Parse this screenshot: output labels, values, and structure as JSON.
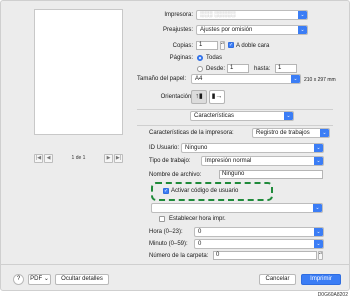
{
  "printer": {
    "label": "Impresora:",
    "value": "░░░ ░░░░░"
  },
  "presets": {
    "label": "Preajustes:",
    "value": "Ajustes por omisión"
  },
  "copies": {
    "label": "Copias:",
    "value": "1",
    "two_sided_label": "A doble cara"
  },
  "pages": {
    "label": "Páginas:",
    "all_label": "Todas",
    "from_label": "Desde:",
    "from_value": "1",
    "to_label": "hasta:",
    "to_value": "1"
  },
  "paper_size": {
    "label": "Tamaño del papel:",
    "value": "A4",
    "dims": "210 x 297 mm"
  },
  "orientation": {
    "label": "Orientación:",
    "portrait_glyph": "↑▮",
    "landscape_glyph": "▮→"
  },
  "section_menu": {
    "value": "Características"
  },
  "printer_features": {
    "label": "Características de la impresora:",
    "value": "Registro de trabajos"
  },
  "user_id": {
    "label": "ID Usuario:",
    "value": "Ninguno"
  },
  "job_type": {
    "label": "Tipo de trabajo:",
    "value": "Impresión normal"
  },
  "file_name": {
    "label": "Nombre de archivo:",
    "value": "Ninguno"
  },
  "user_code": {
    "label": "Activar código de usuario"
  },
  "set_time": {
    "label": "Establecer hora impr."
  },
  "hour": {
    "label": "Hora (0–23):",
    "value": "0"
  },
  "minute": {
    "label": "Minuto (0–59):",
    "value": "0"
  },
  "folder_number": {
    "label": "Número de la carpeta:",
    "value": "0"
  },
  "pager": {
    "prev_first": "|◀",
    "prev": "◀",
    "text": "1 de 1",
    "next": "▶",
    "next_last": "▶|"
  },
  "footer": {
    "help": "?",
    "pdf": "PDF",
    "details": "Ocultar detalles",
    "cancel": "Cancelar",
    "print": "Imprimir"
  },
  "figure_code": "D0G60A8202",
  "icons": {
    "chevron": "⌄",
    "check": "✓",
    "stepper": "▴▾"
  },
  "colors": {
    "accent": "#3b7df5",
    "highlight": "#1f8a3a"
  }
}
